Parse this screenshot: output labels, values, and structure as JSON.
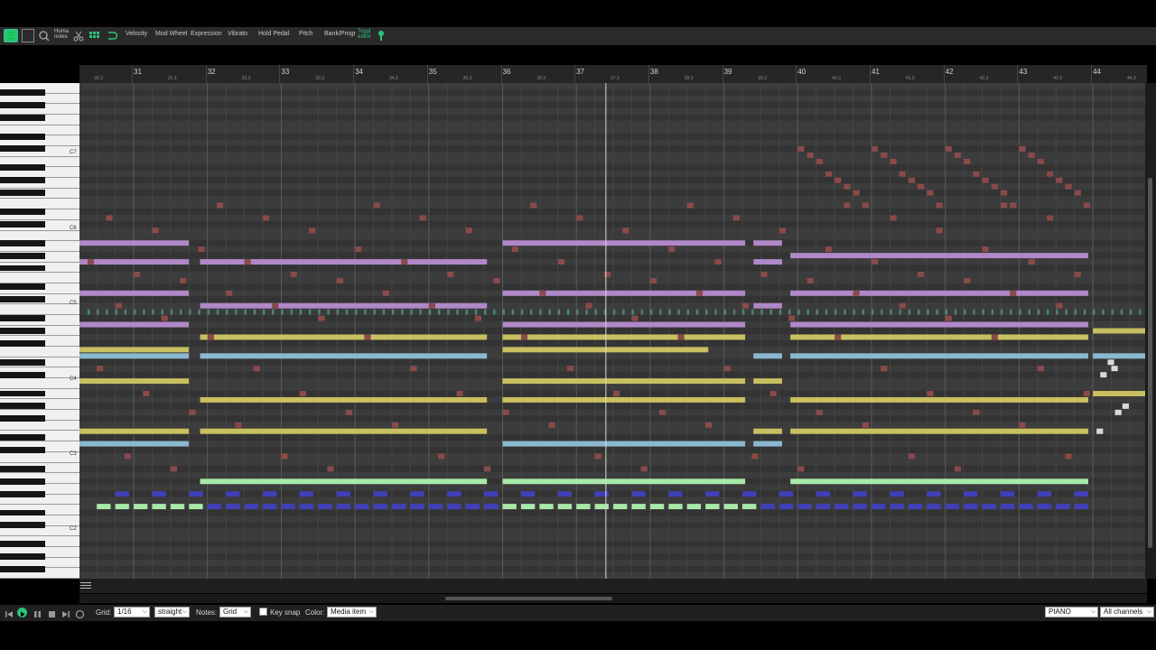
{
  "toolbar": {
    "humanize_label": "Huma notes",
    "buttons": [
      "Velocity",
      "Mod Wheel",
      "Expression",
      "Vibrato",
      "Hold Pedal",
      "Pitch",
      "Bank/Progr",
      "Toggl editor"
    ],
    "icons": [
      "view-list-icon",
      "panel-icon",
      "magnifier-icon",
      "humanize-icon",
      "scissors-icon",
      "grid-icon",
      "loop-icon",
      "pin-icon"
    ]
  },
  "ruler": {
    "bars": [
      "31",
      "32",
      "33",
      "34",
      "35",
      "36",
      "37",
      "38",
      "39",
      "40",
      "41",
      "42",
      "43",
      "44"
    ],
    "sub_labels": [
      "30.3",
      "31.3",
      "32.3",
      "33.3",
      "34.3",
      "35.3",
      "36.3",
      "37.3",
      "38.3",
      "39.3",
      "40.3",
      "41.3",
      "42.3",
      "43.3",
      "44.3"
    ]
  },
  "keyboard": {
    "octave_labels": [
      "C7",
      "C6",
      "C5",
      "C4",
      "C3",
      "C2",
      "C1"
    ]
  },
  "piano_roll": {
    "playhead_bar": 37.4,
    "note_colors": {
      "pad": "#b088c8",
      "bass": "#a8e8a8",
      "lead": "#c8c060",
      "string": "#8ab8d0",
      "arp": "#8a4a4a",
      "drum": "#4040b8",
      "accent": "#d8d8d8"
    }
  },
  "bottom": {
    "grid_label": "Grid:",
    "grid_value": "1/16",
    "swing_value": "straight",
    "notes_label": "Notes:",
    "notes_value": "Grid",
    "key_snap_label": "Key snap",
    "color_label": "Color:",
    "color_value": "Media item",
    "track_value": "PIANO",
    "channel_value": "All channels"
  },
  "colors": {
    "accent_green": "#2ec27e",
    "grid_bg": "#3b3b3b"
  }
}
